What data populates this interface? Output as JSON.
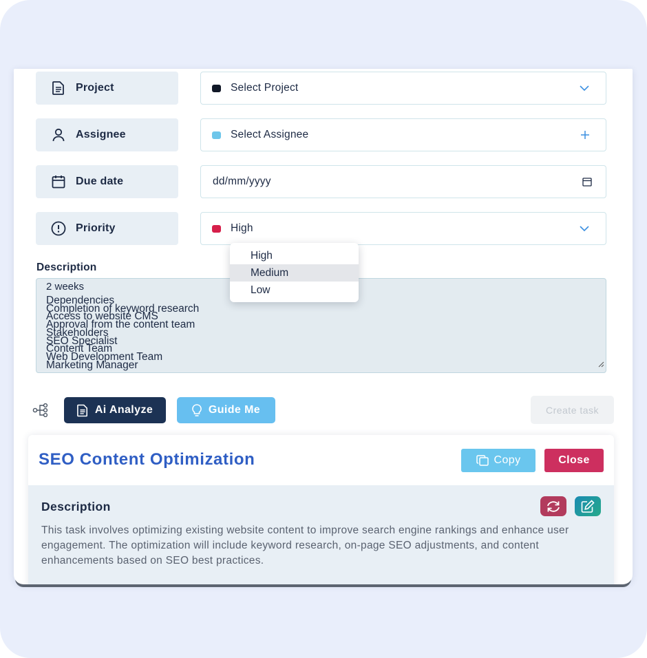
{
  "form": {
    "project": {
      "label": "Project",
      "value": "Select Project",
      "dot_color": "#111827"
    },
    "assignee": {
      "label": "Assignee",
      "value": "Select Assignee",
      "dot_color": "#6ec6ea"
    },
    "due_date": {
      "label": "Due date",
      "placeholder": "dd/mm/yyyy"
    },
    "priority": {
      "label": "Priority",
      "value": "High",
      "dot_color": "#d61f4a",
      "options": [
        "High",
        "Medium",
        "Low"
      ],
      "highlighted": "Medium"
    },
    "description": {
      "label": "Description",
      "lines": [
        "2 weeks",
        "Dependencies",
        "Completion of keyword research",
        "Access to website CMS",
        "Approval from the content team",
        "Stakeholders",
        "SEO Specialist",
        "Content Team",
        "Web Development Team",
        "Marketing Manager"
      ]
    }
  },
  "actions": {
    "ai_analyze": "Ai Analyze",
    "guide_me": "Guide Me",
    "create_task": "Create task"
  },
  "result": {
    "title": "SEO Content Optimization",
    "copy": "Copy",
    "close": "Close",
    "section_label": "Description",
    "text": "This task involves optimizing existing website content to improve search engine rankings and enhance user engagement. The optimization will include keyword research, on-page SEO adjustments, and content enhancements based on SEO best practices."
  },
  "colors": {
    "navy": "#1c3254",
    "sky": "#67bff0",
    "title_blue": "#2f5ec4",
    "close_red": "#cd2f5f"
  }
}
